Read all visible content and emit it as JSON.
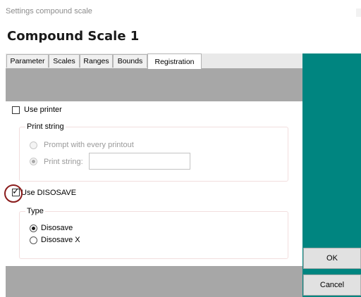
{
  "window": {
    "title": "Settings compound scale"
  },
  "page": {
    "heading": "Compound Scale 1"
  },
  "tabs": [
    {
      "label": "Parameter",
      "active": false
    },
    {
      "label": "Scales",
      "active": false
    },
    {
      "label": "Ranges",
      "active": false
    },
    {
      "label": "Bounds",
      "active": false
    },
    {
      "label": "Registration",
      "active": true
    }
  ],
  "use_printer": {
    "label": "Use printer",
    "checked": false
  },
  "print_string_group": {
    "title": "Print string",
    "options": [
      {
        "label": "Prompt with every printout",
        "selected": false,
        "enabled": false
      },
      {
        "label": "Print string:",
        "selected": true,
        "enabled": false
      }
    ],
    "input_value": ""
  },
  "use_disosave": {
    "label": "Use DISOSAVE",
    "checked": true
  },
  "type_group": {
    "title": "Type",
    "options": [
      {
        "label": "Disosave",
        "selected": true
      },
      {
        "label": "Disosave X",
        "selected": false
      }
    ]
  },
  "buttons": {
    "ok": "OK",
    "cancel": "Cancel"
  },
  "colors": {
    "accent_panel": "#008580",
    "highlight_circle": "#8a1c1c"
  },
  "icons": {
    "checkmark": "checkmark-icon",
    "radio_dot": "radio-dot-icon"
  }
}
